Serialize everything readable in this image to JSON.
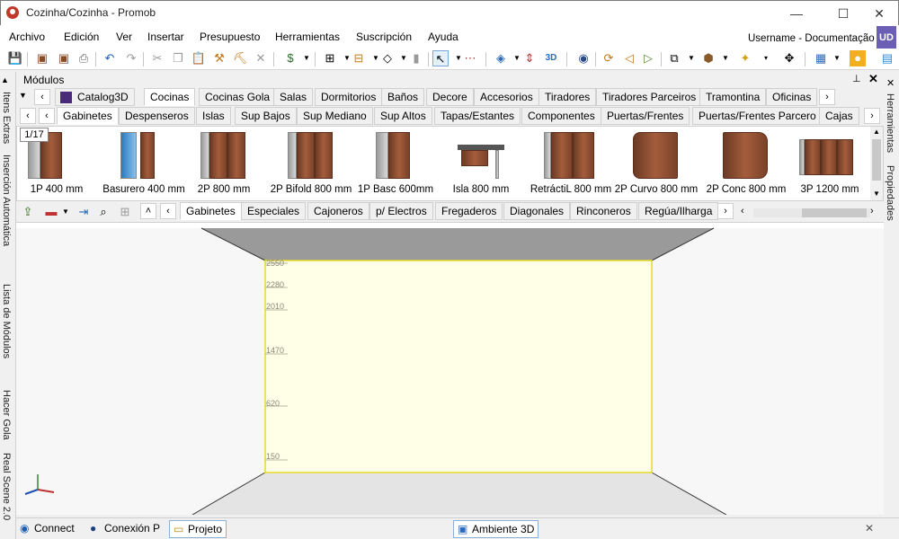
{
  "window": {
    "title": "Cozinha/Cozinha - Promob",
    "minimize": "—",
    "maximize": "☐",
    "close": "✕"
  },
  "menu": [
    "Archivo",
    "Edición",
    "Ver",
    "Insertar",
    "Presupuesto",
    "Herramientas",
    "Suscripción",
    "Ayuda"
  ],
  "user": {
    "name": "Username - Documentação",
    "initials": "UD"
  },
  "modulos": {
    "title": "Módulos",
    "pin": "📌",
    "close": "✕"
  },
  "catalog_tabs": [
    "Catalog3D",
    "Cocinas",
    "Cocinas Gola",
    "Salas",
    "Dormitorios",
    "Baños",
    "Decore",
    "Accesorios",
    "Tiradores",
    "Tiradores Parceiros",
    "Tramontina",
    "Oficinas"
  ],
  "catalog_active": "Cocinas",
  "category_tabs": [
    "Gabinetes",
    "Despenseros",
    "Islas",
    "Sup Bajos",
    "Sup Mediano",
    "Sup Altos",
    "Tapas/Estantes",
    "Componentes",
    "Puertas/Frentes",
    "Puertas/Frentes Parcero",
    "Cajas"
  ],
  "category_active": "Gabinetes",
  "page_counter": "1/17",
  "items": [
    "1P 400 mm",
    "Basurero 400 mm",
    "2P 800 mm",
    "2P Bifold 800 mm",
    "1P Basc 600mm",
    "Isla 800 mm",
    "RetráctiL 800 mm",
    "2P Curvo 800  mm",
    "2P Conc 800  mm",
    "3P 1200 mm"
  ],
  "sub_tabs": [
    "Gabinetes",
    "Especiales",
    "Cajoneros",
    "p/ Electros",
    "Fregaderos",
    "Diagonales",
    "Rinconeros",
    "Regúa/Ilharga"
  ],
  "sub_active": "Gabinetes",
  "left_tabs": [
    "Itens Extras",
    "Inserción Automática",
    "Lista de Módulos",
    "Hacer Gola",
    "Real Scene 2.0"
  ],
  "right_tabs": [
    "Herramientas",
    "Propiedades"
  ],
  "wall_marks": [
    "2550",
    "2280",
    "2010",
    "1470",
    "620",
    "150"
  ],
  "bottom_tabs": [
    "Connect",
    "Conexión P",
    "Projeto"
  ],
  "bottom_active": "Projeto",
  "viewport_tab": "Ambiente 3D",
  "viewport_close": "✕",
  "colors": {
    "wall": "#fffee6",
    "wall_border": "#e8d92a",
    "floor": "#e6e6e6",
    "ceiling": "#9a9a9a",
    "accent": "#6b5fb5"
  }
}
